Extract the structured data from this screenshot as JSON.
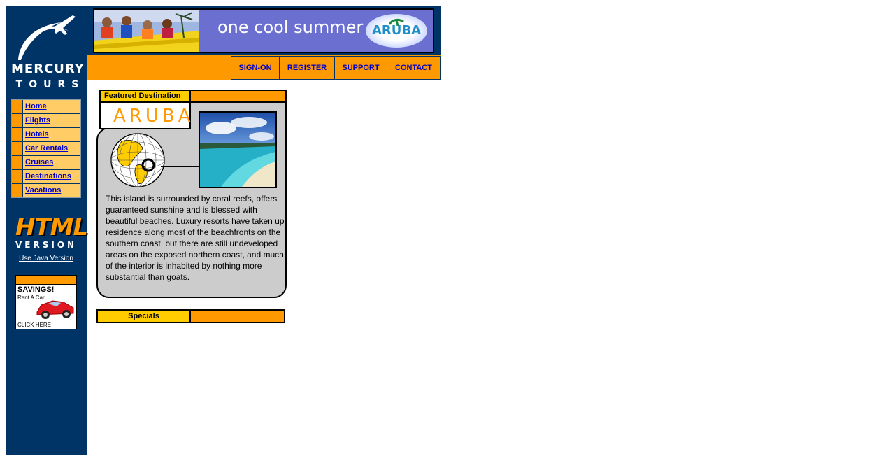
{
  "logo": {
    "line1": "MERCURY",
    "line2": "TOURS"
  },
  "sidebar": {
    "items": [
      {
        "label": "Home"
      },
      {
        "label": "Flights"
      },
      {
        "label": "Hotels"
      },
      {
        "label": "Car Rentals"
      },
      {
        "label": "Cruises"
      },
      {
        "label": "Destinations"
      },
      {
        "label": "Vacations"
      }
    ]
  },
  "html_version": {
    "big": "HTML",
    "small": "VERSION",
    "java_link": "Use Java Version"
  },
  "ad": {
    "line1": "SAVINGS!",
    "line2": "Rent A Car",
    "line3": "CLICK HERE"
  },
  "banner": {
    "text": "one cool summer",
    "brand": "ARUBA"
  },
  "nav": {
    "signon": "SIGN-ON",
    "register": "REGISTER",
    "support": "SUPPORT",
    "contact": "CONTACT"
  },
  "featured": {
    "label": "Featured Destination",
    "title": "ARUBA",
    "description": "This island is surrounded by coral reefs, offers guaranteed sunshine and is blessed with beautiful beaches. Luxury resorts have taken up residence along most of the beachfronts on the southern coast, but there are still undeveloped areas on the exposed northern coast, and much of the interior is inhabited by nothing more substantial than goats."
  },
  "specials": {
    "label": "Specials"
  },
  "colors": {
    "navy": "#003366",
    "orange": "#ff9900",
    "gold": "#ffcc00",
    "navlight": "#ffcc66"
  }
}
